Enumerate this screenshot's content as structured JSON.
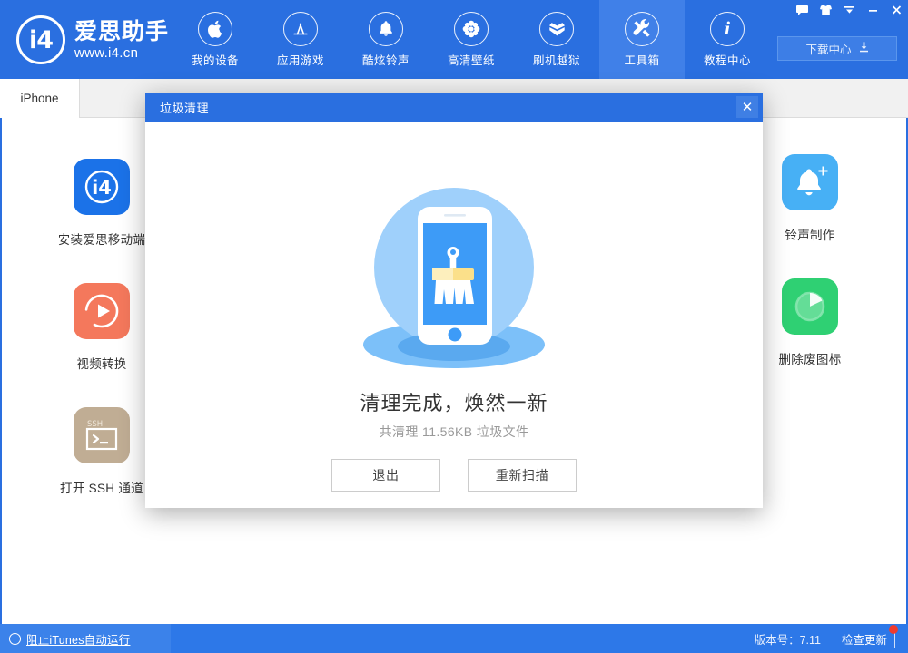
{
  "app": {
    "brand_title": "爱思助手",
    "brand_url": "www.i4.cn",
    "brand_mark": "i4",
    "accent_blue": "#2a6fe0",
    "accent_blue_active": "#4080e8"
  },
  "titlebar": {
    "buttons": [
      {
        "name": "feedback-icon",
        "glyph": "speech-bubble"
      },
      {
        "name": "skin-icon",
        "glyph": "t-shirt"
      },
      {
        "name": "menu-dropdown-icon",
        "glyph": "chevron-down-bar"
      },
      {
        "name": "minimize-icon",
        "glyph": "minus"
      },
      {
        "name": "close-icon",
        "glyph": "cross"
      }
    ]
  },
  "nav": {
    "items": [
      {
        "label": "我的设备",
        "icon": "apple-icon",
        "active": false
      },
      {
        "label": "应用游戏",
        "icon": "appstore-icon",
        "active": false
      },
      {
        "label": "酷炫铃声",
        "icon": "bell-icon",
        "active": false
      },
      {
        "label": "高清壁纸",
        "icon": "flower-icon",
        "active": false
      },
      {
        "label": "刷机越狱",
        "icon": "open-box-icon",
        "active": false
      },
      {
        "label": "工具箱",
        "icon": "wrench-icon",
        "active": true
      },
      {
        "label": "教程中心",
        "icon": "info-icon",
        "active": false
      }
    ],
    "download_center": "下载中心"
  },
  "device_tabs": [
    {
      "label": "iPhone",
      "active": true
    }
  ],
  "tools": {
    "left": [
      {
        "label": "安装爱思移动端",
        "icon": "i4-app-icon",
        "color": "#1b72e8"
      },
      {
        "label": "视频转换",
        "icon": "video-play-icon",
        "color": "#f4785c"
      },
      {
        "label": "打开 SSH 通道",
        "icon": "ssh-terminal-icon",
        "color": "#c0ad94"
      }
    ],
    "right": [
      {
        "label": "铃声制作",
        "icon": "bell-plus-icon",
        "color": "#47b0f5"
      },
      {
        "label": "删除废图标",
        "icon": "pie-circle-icon",
        "color": "#2fd073"
      }
    ]
  },
  "dialog": {
    "title": "垃圾清理",
    "close_glyph": "✕",
    "illustration": "phone-broom-clean-illustration",
    "heading": "清理完成，焕然一新",
    "subtext": "共清理 11.56KB 垃圾文件",
    "buttons": [
      {
        "label": "退出",
        "name": "exit-button"
      },
      {
        "label": "重新扫描",
        "name": "rescan-button"
      }
    ]
  },
  "footer": {
    "block_itunes_label": "阻止iTunes自动运行",
    "version_label": "版本号：7.11",
    "update_label": "检查更新",
    "update_badge_color": "#ef3b2f"
  }
}
